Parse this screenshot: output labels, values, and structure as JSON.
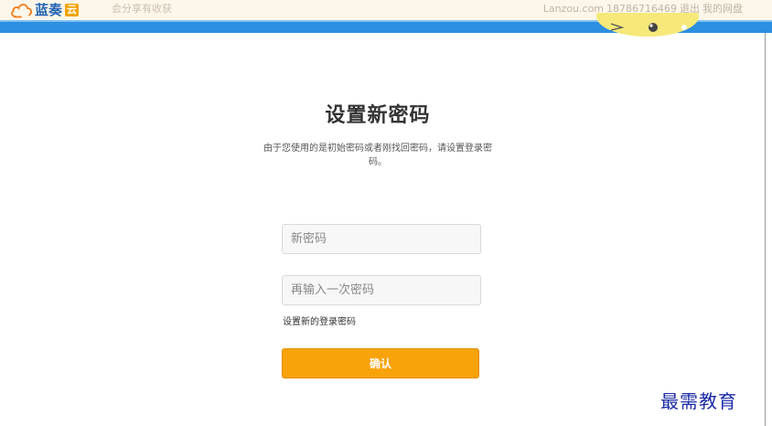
{
  "header": {
    "logo_text": "蓝奏",
    "logo_badge": "云",
    "slogan": "会分享有收获",
    "site": "Lanzou.com",
    "phone": "18786716469",
    "logout": "退出",
    "my_disk": "我的网盘"
  },
  "form": {
    "title": "设置新密码",
    "description": "由于您使用的是初始密码或者刚找回密码，请设置登录密码。",
    "new_password_placeholder": "新密码",
    "confirm_password_placeholder": "再输入一次密码",
    "hint": "设置新的登录密码",
    "submit_label": "确认"
  },
  "watermark": "最需教育",
  "colors": {
    "brand_blue": "#2c8fe0",
    "accent_orange": "#f9a30b",
    "header_bg": "#fdf6ea"
  },
  "icons": {
    "logo": "cloud-icon",
    "mascot": "cartoon-face-icon"
  }
}
